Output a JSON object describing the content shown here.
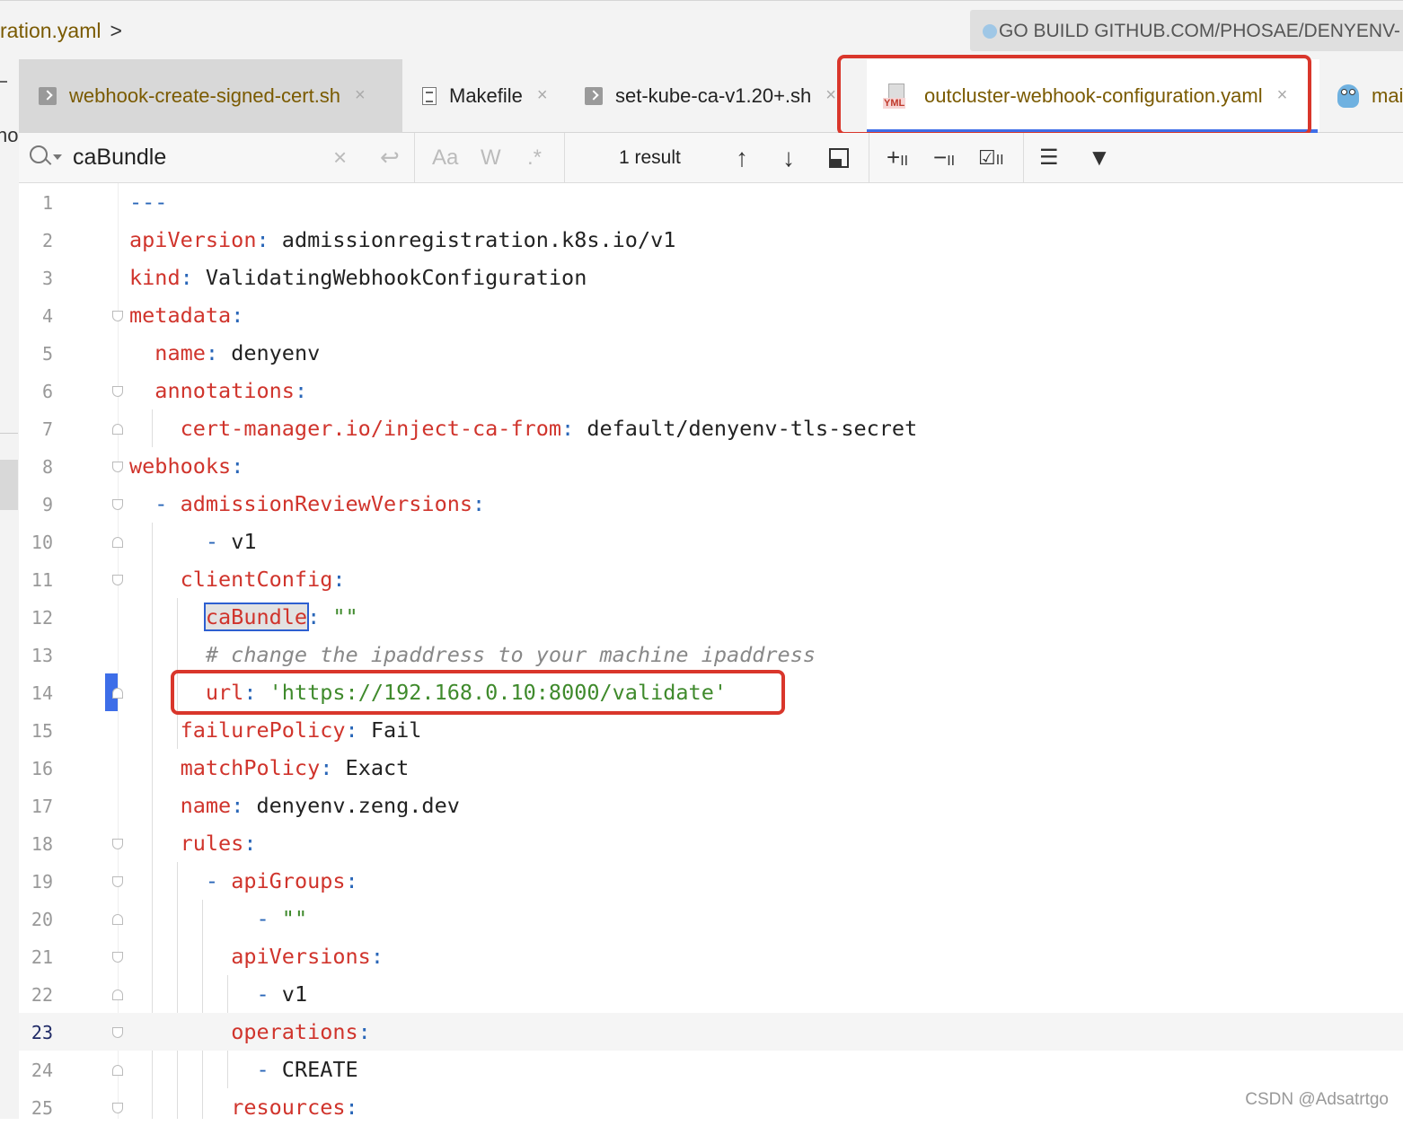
{
  "breadcrumb": {
    "file": "ration.yaml",
    "chevron": ">"
  },
  "run_config": {
    "label": "GO BUILD GITHUB.COM/PHOSAE/DENYENV-"
  },
  "left_panel": {
    "fragment": "ho"
  },
  "tabs": [
    {
      "label": "webhook-create-signed-cert.sh",
      "icon": "shell-script-icon",
      "close": "×"
    },
    {
      "label": "Makefile",
      "icon": "makefile-icon",
      "close": "×"
    },
    {
      "label": "set-kube-ca-v1.20+.sh",
      "icon": "shell-script-icon",
      "close": "×"
    },
    {
      "label": "outcluster-webhook-configuration.yaml",
      "icon": "yaml-file-icon",
      "icon_text": "YML",
      "close": "×",
      "active": true
    },
    {
      "label": "mai",
      "icon": "go-gopher-icon"
    }
  ],
  "search": {
    "value": "caBundle",
    "clear": "×",
    "match_case": "Aa",
    "words": "W",
    "regex": ".*",
    "result_count": "1 result"
  },
  "editor": {
    "lines": [
      "1",
      "2",
      "3",
      "4",
      "5",
      "6",
      "7",
      "8",
      "9",
      "10",
      "11",
      "12",
      "13",
      "14",
      "15",
      "16",
      "17",
      "18",
      "19",
      "20",
      "21",
      "22",
      "23",
      "24",
      "25"
    ],
    "current_line": "23",
    "code": {
      "l1": "---",
      "l2_key": "apiVersion",
      "l2_val": "admissionregistration.k8s.io/v1",
      "l3_key": "kind",
      "l3_val": "ValidatingWebhookConfiguration",
      "l4_key": "metadata",
      "l5_key": "name",
      "l5_val": "denyenv",
      "l6_key": "annotations",
      "l7_key": "cert-manager.io/inject-ca-from",
      "l7_val": "default/denyenv-tls-secret",
      "l8_key": "webhooks",
      "l9_key": "admissionReviewVersions",
      "l10_val": "v1",
      "l11_key": "clientConfig",
      "l12_key": "caBundle",
      "l12_val": "\"\"",
      "l13_comment": "# change the ipaddress to your machine ipaddress",
      "l14_key": "url",
      "l14_val": "'https://192.168.0.10:8000/validate'",
      "l15_key": "failurePolicy",
      "l15_val": "Fail",
      "l16_key": "matchPolicy",
      "l16_val": "Exact",
      "l17_key": "name",
      "l17_val": "denyenv.zeng.dev",
      "l18_key": "rules",
      "l19_key": "apiGroups",
      "l20_val": "\"\"",
      "l21_key": "apiVersions",
      "l22_val": "v1",
      "l23_key": "operations",
      "l24_val": "CREATE",
      "l25_key": "resources"
    }
  },
  "watermark": "CSDN @Adsatrtgo",
  "colors": {
    "key": "#d0342c",
    "punct": "#2966b8",
    "string": "#3f8a2c",
    "highlight_box": "#d9362b",
    "active_tab_underline": "#3f6ee8"
  }
}
